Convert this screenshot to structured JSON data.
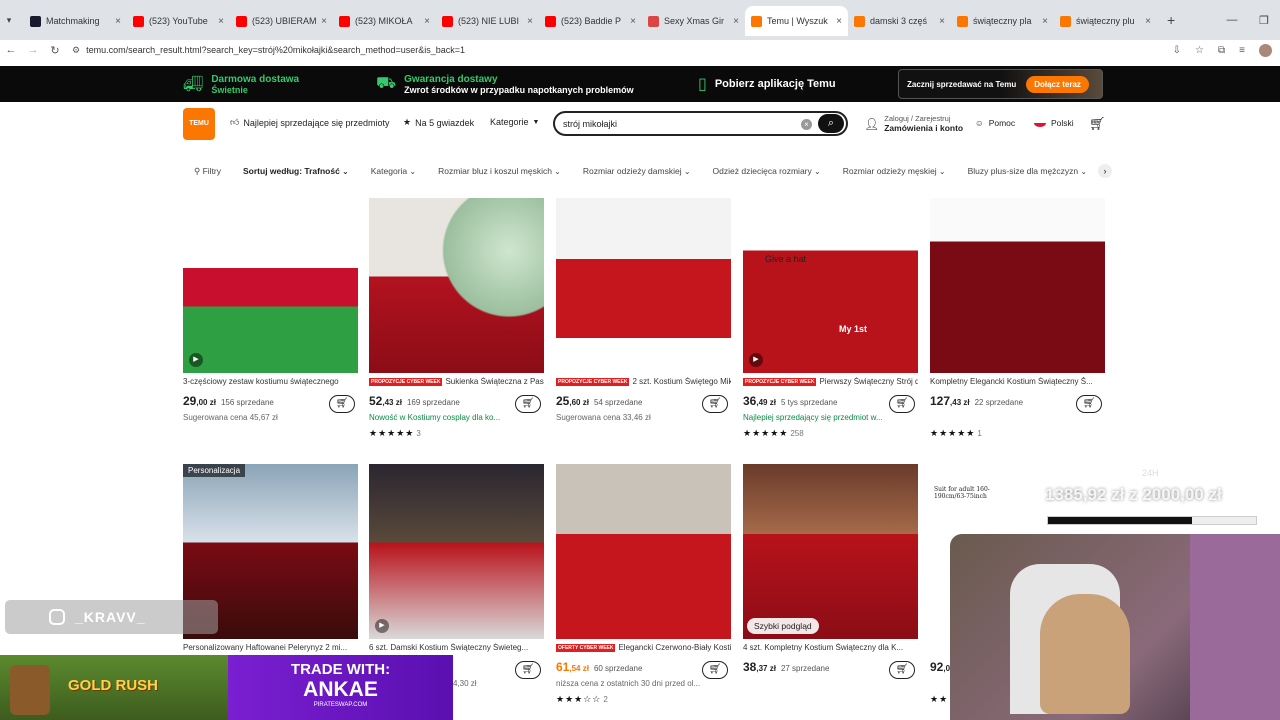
{
  "browser": {
    "tabs": [
      {
        "label": "Matchmaking",
        "color": "#1a1a2e",
        "active": false
      },
      {
        "label": "(523) YouTube",
        "color": "#ff0000",
        "active": false
      },
      {
        "label": "(523) UBIERAM",
        "color": "#ff0000",
        "active": false
      },
      {
        "label": "(523) MIKOŁA",
        "color": "#ff0000",
        "active": false
      },
      {
        "label": "(523) NIE LUBI",
        "color": "#ff0000",
        "active": false
      },
      {
        "label": "(523) Baddie P",
        "color": "#ff0000",
        "active": false
      },
      {
        "label": "Sexy Xmas Gir",
        "color": "#d44",
        "active": false
      },
      {
        "label": "Temu | Wyszuk",
        "color": "#fb7701",
        "active": true
      },
      {
        "label": "damski 3 częś",
        "color": "#fb7701",
        "active": false
      },
      {
        "label": "świąteczny pla",
        "color": "#fb7701",
        "active": false
      },
      {
        "label": "świąteczny plu",
        "color": "#fb7701",
        "active": false
      }
    ],
    "url": "temu.com/search_result.html?search_key=strój%20mikołajki&search_method=user&is_back=1"
  },
  "promo": {
    "free_shipping_title": "Darmowa dostawa",
    "free_shipping_sub": "Świetnie",
    "guarantee_title": "Gwarancja dostawy",
    "guarantee_sub": "Zwrot środków w przypadku napotkanych problemów",
    "app_label": "Pobierz aplikację Temu",
    "sell_label": "Zacznij sprzedawać na Temu",
    "sell_button": "Dołącz teraz"
  },
  "header": {
    "logo": "TEMU",
    "nav_bestsellers": "Najlepiej sprzedające się przedmioty",
    "nav_5stars": "Na 5 gwiazdek",
    "nav_category": "Kategorie",
    "search_value": "strój mikołajki",
    "login_line1": "Zaloguj / Zarejestruj",
    "login_line2": "Zamówienia i konto",
    "help": "Pomoc",
    "language": "Polski"
  },
  "filters": [
    "Filtry",
    "Sortuj według: Trafność",
    "Kategoria",
    "Rozmiar bluz i koszul męskich",
    "Rozmiar odzieży damskiej",
    "Odzież dziecięca rozmiary",
    "Rozmiar odzieży męskiej",
    "Bluzy plus-size dla mężczyzn"
  ],
  "products": [
    {
      "name": "3-częściowy zestaw kostiumu świątecznego",
      "price_main": "29",
      "price_dec": ",00 zł",
      "sold": "156 sprzedane",
      "sub": "Sugerowana cena 45,67 zł",
      "sub_style": "",
      "badge": "",
      "stars": "",
      "reviews": "",
      "price_orange": false
    },
    {
      "name": "Sukienka Świąteczna z Paskiem",
      "price_main": "52",
      "price_dec": ",43 zł",
      "sold": "169 sprzedane",
      "sub": "Nowość w Kostiumy cosplay dla ko...",
      "sub_style": "green",
      "badge": "PROPOZYCJE CYBER WEEK",
      "stars": "★★★★★",
      "reviews": "3",
      "price_orange": false
    },
    {
      "name": "2 szt. Kostium Świętego Mikołaj...",
      "price_main": "25",
      "price_dec": ",60 zł",
      "sold": "54 sprzedane",
      "sub": "Sugerowana cena 33,46 zł",
      "sub_style": "",
      "badge": "PROPOZYCJE CYBER WEEK",
      "stars": "",
      "reviews": "",
      "price_orange": false
    },
    {
      "name": "Pierwszy Świąteczny Strój dla Ni...",
      "price_main": "36",
      "price_dec": ",49 zł",
      "sold": "5 tys sprzedane",
      "sub": "Najlepiej sprzedający się przedmiot w...",
      "sub_style": "green",
      "badge": "PROPOZYCJE CYBER WEEK",
      "stars": "★★★★★",
      "reviews": "258",
      "price_orange": false
    },
    {
      "name": "Kompletny Elegancki Kostium Świąteczny Š...",
      "price_main": "127",
      "price_dec": ",43 zł",
      "sold": "22 sprzedane",
      "sub": "",
      "sub_style": "",
      "badge": "",
      "stars": "★★★★★",
      "reviews": "1",
      "price_orange": false
    },
    {
      "name": "Personalizowany Haftowanei Pelerynyz 2 mi...",
      "price_main": "",
      "price_dec": "",
      "sold": "",
      "sub": "",
      "sub_style": "",
      "badge": "",
      "stars": "",
      "reviews": "",
      "price_orange": false,
      "tag": "Personalizacja"
    },
    {
      "name": "6 szt. Damski Kostium Świąteczny Świeteg...",
      "price_main": "",
      "price_dec": "",
      "sold": "",
      "sub": "4,30 zł",
      "sub_style": "",
      "badge": "",
      "stars": "",
      "reviews": "",
      "price_orange": false
    },
    {
      "name": "Elegancki Czerwono-Biały Kosti...",
      "price_main": "61",
      "price_dec": ",54 zł",
      "sold": "60 sprzedane",
      "sub": "niższa cena z ostatnich 30 dni przed ol...",
      "sub_style": "",
      "badge": "OFERTY CYBER WEEK",
      "stars": "★★★☆☆",
      "reviews": "2",
      "price_orange": true
    },
    {
      "name": "4 szt. Kompletny Kostium Świąteczny dla K...",
      "price_main": "38",
      "price_dec": ",37 zł",
      "sold": "27 sprzedane",
      "sub": "",
      "sub_style": "",
      "badge": "",
      "stars": "",
      "reviews": "",
      "price_orange": false,
      "quick": "Szybki podgląd"
    },
    {
      "name": "",
      "price_main": "92",
      "price_dec": ",0",
      "sold": "",
      "sub": "",
      "sub_style": "",
      "badge": "",
      "stars": "★★",
      "reviews": "",
      "price_orange": false
    }
  ],
  "image_texts": {
    "give_hat": "Give a hat",
    "my1st": "My 1st",
    "suit_adult": "Suit for adult 160-190cm/63-75inch"
  },
  "stream_overlay": {
    "instagram": "_KRAVV_",
    "game": "GOLD RUSH",
    "trade_line1": "TRADE WITH:",
    "trade_line2": "ANKAE",
    "trade_site": "PIRATESWAP.COM",
    "goal_label": "24H",
    "goal_text": "1385,92 zł z 2000,00 zł",
    "goal_progress": 0.69
  }
}
